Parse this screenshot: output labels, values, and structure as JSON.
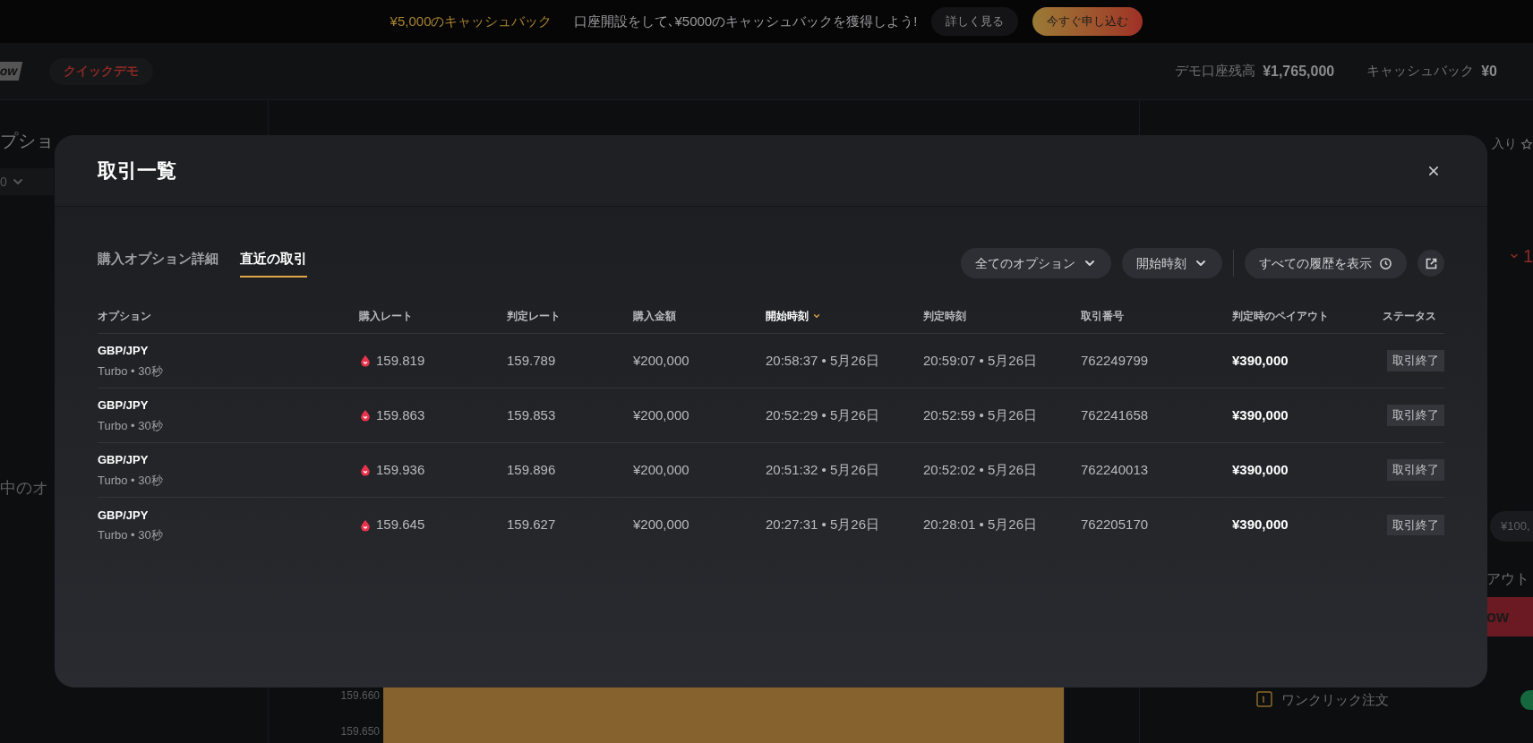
{
  "banner": {
    "headline": "¥5,000のキャッシュバック",
    "message": "口座開設をして､¥5000のキャッシュバックを獲得しよう!",
    "details_button": "詳しく見る",
    "apply_button": "今すぐ申し込む"
  },
  "header": {
    "logo_fragment": "ow",
    "demo_badge": "クイックデモ",
    "balance_label": "デモ口座残高",
    "balance_value": "¥1,765,000",
    "cashback_label": "キャッシュバック",
    "cashback_value": "¥0"
  },
  "background": {
    "left_title": "プショ",
    "left_select": "0",
    "left_text": "中のオ",
    "favorite_label": "入り",
    "rate_fragment": "1",
    "amount_fragment": "¥100,",
    "payout_fragment": "アウト",
    "trade_button": "ow",
    "one_click_label": "ワンクリック注文",
    "one_click_on": true,
    "axis_ticks": [
      "159.660",
      "159.650"
    ]
  },
  "modal": {
    "title": "取引一覧",
    "tabs": [
      {
        "label": "購入オプション詳細",
        "selected": false
      },
      {
        "label": "直近の取引",
        "selected": true
      }
    ],
    "filters": [
      {
        "kind": "dropdown",
        "label": "全てのオプション"
      },
      {
        "kind": "dropdown",
        "label": "開始時刻"
      },
      {
        "kind": "history",
        "label": "すべての履歴を表示"
      },
      {
        "kind": "external"
      }
    ],
    "table": {
      "columns": [
        {
          "label": "オプション",
          "sorted": false
        },
        {
          "label": "購入レート",
          "sorted": false
        },
        {
          "label": "判定レート",
          "sorted": false
        },
        {
          "label": "購入金額",
          "sorted": false
        },
        {
          "label": "開始時刻",
          "sorted": true
        },
        {
          "label": "判定時刻",
          "sorted": false
        },
        {
          "label": "取引番号",
          "sorted": false
        },
        {
          "label": "判定時のペイアウト",
          "sorted": false
        },
        {
          "label": "ステータス",
          "sorted": false
        }
      ],
      "rows": [
        {
          "option": "GBP/JPY",
          "type": "Turbo • 30秒",
          "buy_rate": "159.819",
          "judge_rate": "159.789",
          "amount": "¥200,000",
          "start_time": "20:58:37 • 5月26日",
          "end_time": "20:59:07 • 5月26日",
          "trade_id": "762249799",
          "payout": "¥390,000",
          "status": "取引終了"
        },
        {
          "option": "GBP/JPY",
          "type": "Turbo • 30秒",
          "buy_rate": "159.863",
          "judge_rate": "159.853",
          "amount": "¥200,000",
          "start_time": "20:52:29 • 5月26日",
          "end_time": "20:52:59 • 5月26日",
          "trade_id": "762241658",
          "payout": "¥390,000",
          "status": "取引終了"
        },
        {
          "option": "GBP/JPY",
          "type": "Turbo • 30秒",
          "buy_rate": "159.936",
          "judge_rate": "159.896",
          "amount": "¥200,000",
          "start_time": "20:51:32 • 5月26日",
          "end_time": "20:52:02 • 5月26日",
          "trade_id": "762240013",
          "payout": "¥390,000",
          "status": "取引終了"
        },
        {
          "option": "GBP/JPY",
          "type": "Turbo • 30秒",
          "buy_rate": "159.645",
          "judge_rate": "159.627",
          "amount": "¥200,000",
          "start_time": "20:27:31 • 5月26日",
          "end_time": "20:28:01 • 5月26日",
          "trade_id": "762205170",
          "payout": "¥390,000",
          "status": "取引終了"
        }
      ]
    }
  }
}
